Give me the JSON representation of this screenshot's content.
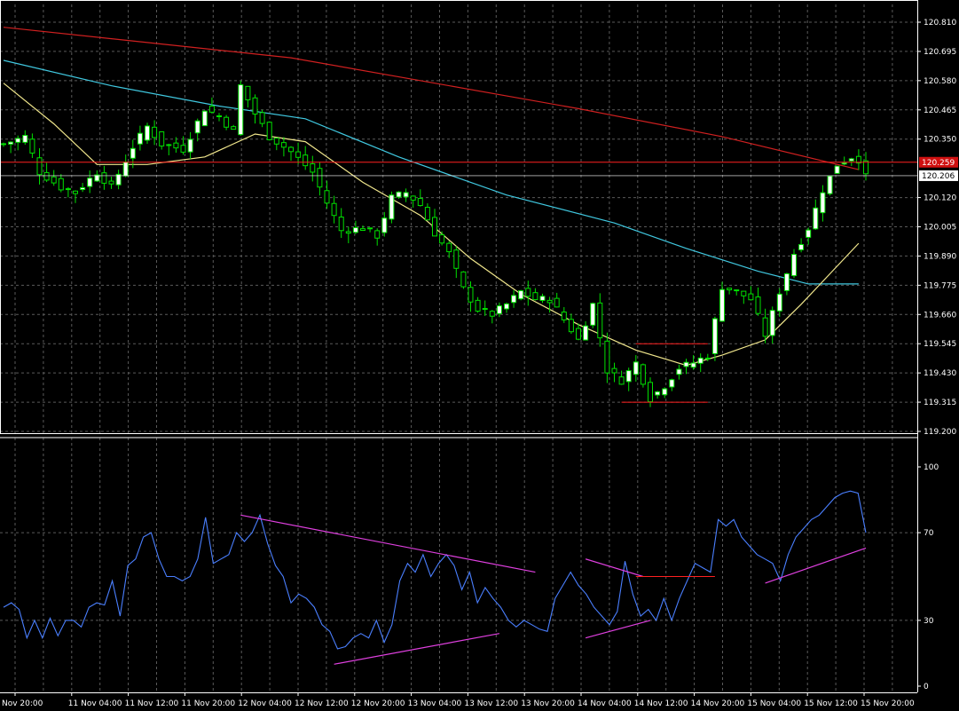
{
  "colors": {
    "background": "#000000",
    "grid": "#5a5a5a",
    "axis": "#ffffff",
    "bull_body": "#ffffff",
    "bull_wick": "#00e000",
    "bear_body": "#000000",
    "bear_outline": "#00e000",
    "ma_fast": "#f0e68c",
    "ma_mid": "#40c8e0",
    "ma_slow": "#d02020",
    "rsi": "#4a7fff",
    "trendline": "#e040e0",
    "level_red": "#ff2020",
    "bid_line": "#ffffff",
    "price_badge": "#d01010"
  },
  "chart_data": [
    {
      "type": "candlestick",
      "title": "",
      "price_ticks": [
        "120.810",
        "120.695",
        "120.580",
        "120.465",
        "120.350",
        "120.120",
        "120.005",
        "119.890",
        "119.775",
        "119.660",
        "119.545",
        "119.430",
        "119.315",
        "119.200"
      ],
      "ylim": [
        119.2,
        120.81
      ],
      "current_price_label": "120.259",
      "bid_label": "120.206",
      "current_price": 120.259,
      "bid_price": 120.206,
      "levels": [
        {
          "price": 119.545,
          "from_bar": 88,
          "to_bar": 98
        },
        {
          "price": 119.315,
          "from_bar": 86,
          "to_bar": 98
        }
      ],
      "moving_averages": [
        {
          "key": "ma_slow",
          "points": [
            [
              0,
              120.79
            ],
            [
              20,
              120.73
            ],
            [
              40,
              120.67
            ],
            [
              60,
              120.57
            ],
            [
              80,
              120.47
            ],
            [
              100,
              120.36
            ],
            [
              119,
              120.23
            ]
          ]
        },
        {
          "key": "ma_mid",
          "points": [
            [
              0,
              120.66
            ],
            [
              15,
              120.56
            ],
            [
              30,
              120.48
            ],
            [
              42,
              120.43
            ],
            [
              55,
              120.28
            ],
            [
              70,
              120.13
            ],
            [
              85,
              120.02
            ],
            [
              95,
              119.92
            ],
            [
              105,
              119.83
            ],
            [
              112,
              119.78
            ],
            [
              119,
              119.78
            ]
          ]
        },
        {
          "key": "ma_fast",
          "points": [
            [
              0,
              120.57
            ],
            [
              7,
              120.41
            ],
            [
              13,
              120.25
            ],
            [
              20,
              120.25
            ],
            [
              28,
              120.28
            ],
            [
              35,
              120.37
            ],
            [
              42,
              120.34
            ],
            [
              50,
              120.18
            ],
            [
              58,
              120.05
            ],
            [
              65,
              119.88
            ],
            [
              72,
              119.74
            ],
            [
              80,
              119.62
            ],
            [
              88,
              119.52
            ],
            [
              95,
              119.46
            ],
            [
              100,
              119.5
            ],
            [
              106,
              119.56
            ],
            [
              111,
              119.7
            ],
            [
              116,
              119.85
            ],
            [
              119,
              119.94
            ]
          ]
        }
      ]
    },
    {
      "type": "line",
      "title": "",
      "y_ticks": [
        "100",
        "70",
        "30",
        "0"
      ],
      "ylim": [
        0,
        100
      ],
      "series": [
        {
          "values": [
            36,
            38,
            35,
            22,
            30,
            22,
            31,
            23,
            30,
            30,
            27,
            36,
            38,
            37,
            48,
            32,
            55,
            58,
            68,
            70,
            58,
            50,
            50,
            48,
            50,
            58,
            77,
            56,
            58,
            60,
            70,
            66,
            70,
            78,
            65,
            55,
            50,
            38,
            42,
            40,
            36,
            28,
            25,
            17,
            18,
            22,
            24,
            22,
            30,
            20,
            28,
            48,
            56,
            52,
            60,
            50,
            56,
            60,
            55,
            44,
            52,
            38,
            45,
            40,
            36,
            30,
            27,
            30,
            28,
            26,
            25,
            40,
            46,
            52,
            46,
            42,
            36,
            32,
            28,
            34,
            57,
            42,
            32,
            35,
            30,
            40,
            30,
            40,
            48,
            56,
            54,
            52,
            76,
            73,
            76,
            68,
            64,
            60,
            58,
            56,
            48,
            60,
            68,
            72,
            76,
            78,
            82,
            86,
            88,
            89,
            88,
            70
          ]
        }
      ],
      "trendlines": [
        {
          "from": [
            33,
            78
          ],
          "to": [
            74,
            52
          ]
        },
        {
          "from": [
            46,
            10
          ],
          "to": [
            69,
            24
          ]
        },
        {
          "from": [
            81,
            58
          ],
          "to": [
            89,
            50
          ]
        },
        {
          "from": [
            81,
            22
          ],
          "to": [
            90,
            30
          ]
        },
        {
          "from": [
            106,
            47
          ],
          "to": [
            120,
            63
          ]
        }
      ],
      "levels": [
        {
          "value": 50,
          "from_bar": 88,
          "to_bar": 99
        }
      ]
    }
  ],
  "time_labels": [
    "Nov 20:00",
    "11 Nov 04:00",
    "11 Nov 12:00",
    "11 Nov 20:00",
    "12 Nov 04:00",
    "12 Nov 12:00",
    "12 Nov 20:00",
    "13 Nov 04:00",
    "13 Nov 12:00",
    "13 Nov 20:00",
    "14 Nov 04:00",
    "14 Nov 12:00",
    "14 Nov 20:00",
    "15 Nov 04:00",
    "15 Nov 12:00",
    "15 Nov 20:00"
  ]
}
